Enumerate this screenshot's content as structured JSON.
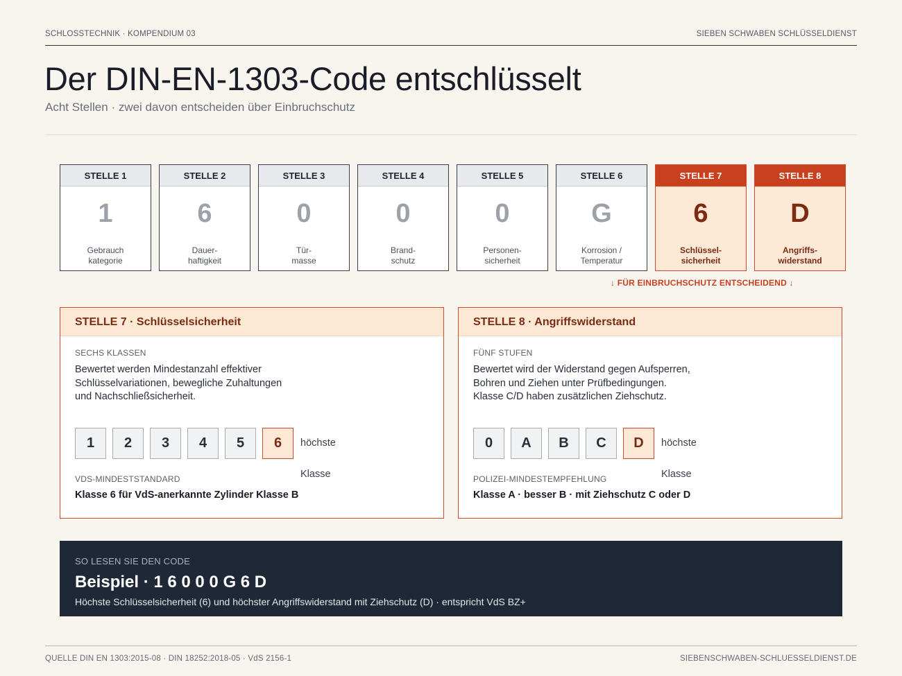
{
  "header": {
    "left": "SCHLOSSTECHNIK · KOMPENDIUM 03",
    "right": "SIEBEN SCHWABEN SCHLÜSSELDIENST"
  },
  "title": "Der DIN-EN-1303-Code entschlüsselt",
  "subtitle": "Acht Stellen · zwei davon entscheiden über Einbruchschutz",
  "digits": [
    {
      "label": "STELLE 1",
      "value": "1",
      "desc1": "Gebrauch",
      "desc2": "kategorie"
    },
    {
      "label": "STELLE 2",
      "value": "6",
      "desc1": "Dauer-",
      "desc2": "haftigkeit"
    },
    {
      "label": "STELLE 3",
      "value": "0",
      "desc1": "Tür-",
      "desc2": "masse"
    },
    {
      "label": "STELLE 4",
      "value": "0",
      "desc1": "Brand-",
      "desc2": "schutz"
    },
    {
      "label": "STELLE 5",
      "value": "0",
      "desc1": "Personen-",
      "desc2": "sicherheit"
    },
    {
      "label": "STELLE 6",
      "value": "G",
      "desc1": "Korrosion /",
      "desc2": "Temperatur"
    },
    {
      "label": "STELLE 7",
      "value": "6",
      "desc1": "Schlüssel-",
      "desc2": "sicherheit"
    },
    {
      "label": "STELLE 8",
      "value": "D",
      "desc1": "Angriffs-",
      "desc2": "widerstand"
    }
  ],
  "highlight_note": "↓ FÜR EINBRUCHSCHUTZ ENTSCHEIDEND ↓",
  "card7": {
    "title": "STELLE 7 · Schlüsselsicherheit",
    "label": "SECHS KLASSEN",
    "text1": "Bewertet werden Mindestanzahl effektiver",
    "text2": "Schlüsselvariationen, bewegliche Zuhaltungen",
    "text3": "und Nachschließsicherheit.",
    "chips": [
      "1",
      "2",
      "3",
      "4",
      "5",
      "6"
    ],
    "chip_note": "höchste Klasse",
    "min_label": "VDS-MINDESTSTANDARD",
    "min_value": "Klasse 6 für VdS-anerkannte Zylinder Klasse B"
  },
  "card8": {
    "title": "STELLE 8 · Angriffswiderstand",
    "label": "FÜNF STUFEN",
    "text1": "Bewertet wird der Widerstand gegen Aufsperren,",
    "text2": "Bohren und Ziehen unter Prüfbedingungen.",
    "text3": "Klasse C/D haben zusätzlichen Ziehschutz.",
    "chips": [
      "0",
      "A",
      "B",
      "C",
      "D"
    ],
    "chip_note": "höchste Klasse",
    "min_label": "POLIZEI-MINDESTEMPFEHLUNG",
    "min_value": "Klasse A · besser B · mit Ziehschutz C oder D"
  },
  "example": {
    "label": "SO LESEN SIE DEN CODE",
    "headline": "Beispiel · 1 6 0 0 0 G 6 D",
    "desc": "Höchste Schlüsselsicherheit (6) und höchster Angriffswiderstand mit Ziehschutz (D) · entspricht VdS BZ+"
  },
  "footer": {
    "left": "QUELLE DIN EN 1303:2015-08 · DIN 18252:2018-05 · VdS 2156-1",
    "right": "SIEBENSCHWABEN-SCHLUESSELDIENST.DE"
  },
  "colors": {
    "accent": "#c8401e",
    "accent_light": "#fde9d6",
    "dark_panel": "#1e2836",
    "background": "#f8f5ef"
  }
}
